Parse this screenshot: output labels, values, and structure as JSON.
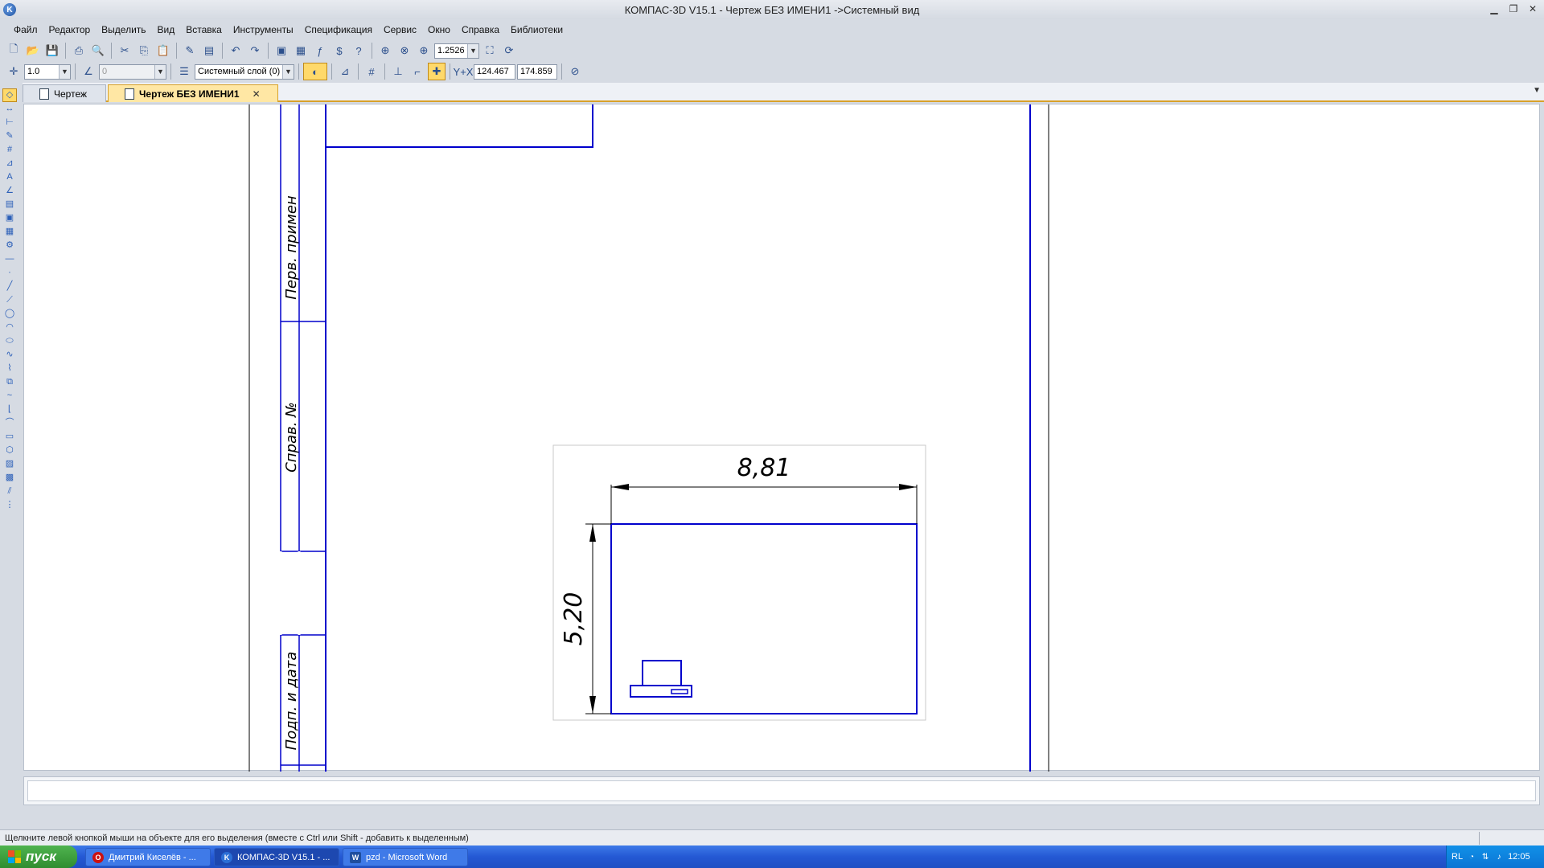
{
  "window": {
    "title": "КОМПАС-3D V15.1 - Чертеж БЕЗ ИМЕНИ1 ->Системный вид"
  },
  "menu": [
    "Файл",
    "Редактор",
    "Выделить",
    "Вид",
    "Вставка",
    "Инструменты",
    "Спецификация",
    "Сервис",
    "Окно",
    "Справка",
    "Библиотеки"
  ],
  "toolbar": {
    "zoom_value": "1.2526",
    "step_value": "1.0",
    "angle_value": "0",
    "layer_value": "Системный слой (0)",
    "coord_x": "124.467",
    "coord_y": "174.859",
    "coord_label": "Y+X"
  },
  "tabs": [
    {
      "label": "Чертеж",
      "active": false
    },
    {
      "label": "Чертеж БЕЗ ИМЕНИ1",
      "active": true
    }
  ],
  "drawing": {
    "frame_labels": [
      "Перв. примен",
      "Справ. №",
      "Подп. и дата"
    ],
    "dimension_width": "8,81",
    "dimension_height": "5,20"
  },
  "statusbar": {
    "hint": "Щелкните левой кнопкой мыши на объекте для его выделения (вместе с Ctrl или Shift - добавить к выделенным)"
  },
  "taskbar": {
    "start_label": "пуск",
    "items": [
      {
        "label": "Дмитрий Киселёв - ...",
        "icon": "opera-icon"
      },
      {
        "label": "КОМПАС-3D V15.1 - ...",
        "icon": "kompas-icon"
      },
      {
        "label": "pzd - Microsoft Word",
        "icon": "word-icon"
      }
    ],
    "lang": "RL",
    "clock": "12:05"
  },
  "colors": {
    "drawing_line": "#0000cc",
    "tab_active": "#ffe7a4",
    "taskbar": "#2458d4"
  }
}
